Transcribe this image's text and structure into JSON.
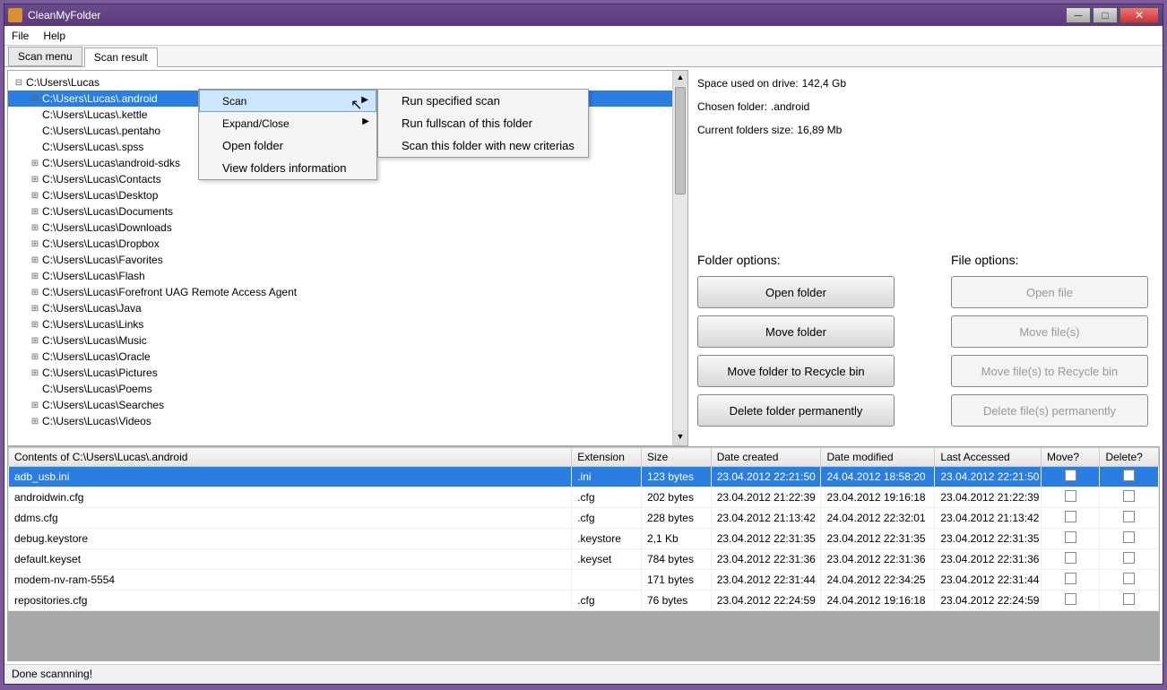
{
  "window": {
    "title": "CleanMyFolder"
  },
  "menubar": [
    "File",
    "Help"
  ],
  "tabs": {
    "items": [
      "Scan menu",
      "Scan result"
    ],
    "active": 1
  },
  "tree": {
    "root": "C:\\Users\\Lucas",
    "selected": "C:\\Users\\Lucas\\.android",
    "children": [
      {
        "label": "C:\\Users\\Lucas\\.android",
        "exp": true
      },
      {
        "label": "C:\\Users\\Lucas\\.kettle",
        "exp": false
      },
      {
        "label": "C:\\Users\\Lucas\\.pentaho",
        "exp": false
      },
      {
        "label": "C:\\Users\\Lucas\\.spss",
        "exp": false
      },
      {
        "label": "C:\\Users\\Lucas\\android-sdks",
        "exp": true
      },
      {
        "label": "C:\\Users\\Lucas\\Contacts",
        "exp": true
      },
      {
        "label": "C:\\Users\\Lucas\\Desktop",
        "exp": true
      },
      {
        "label": "C:\\Users\\Lucas\\Documents",
        "exp": true
      },
      {
        "label": "C:\\Users\\Lucas\\Downloads",
        "exp": true
      },
      {
        "label": "C:\\Users\\Lucas\\Dropbox",
        "exp": true
      },
      {
        "label": "C:\\Users\\Lucas\\Favorites",
        "exp": true
      },
      {
        "label": "C:\\Users\\Lucas\\Flash",
        "exp": true
      },
      {
        "label": "C:\\Users\\Lucas\\Forefront UAG Remote Access Agent",
        "exp": true
      },
      {
        "label": "C:\\Users\\Lucas\\Java",
        "exp": true
      },
      {
        "label": "C:\\Users\\Lucas\\Links",
        "exp": true
      },
      {
        "label": "C:\\Users\\Lucas\\Music",
        "exp": true
      },
      {
        "label": "C:\\Users\\Lucas\\Oracle",
        "exp": true
      },
      {
        "label": "C:\\Users\\Lucas\\Pictures",
        "exp": true
      },
      {
        "label": "C:\\Users\\Lucas\\Poems",
        "exp": false
      },
      {
        "label": "C:\\Users\\Lucas\\Searches",
        "exp": true
      },
      {
        "label": "C:\\Users\\Lucas\\Videos",
        "exp": true
      }
    ]
  },
  "context_menu_1": [
    "Scan",
    "Expand/Close",
    "Open folder",
    "View folders information"
  ],
  "context_menu_2": [
    "Run specified scan",
    "Run fullscan of this folder",
    "Scan this folder with new criterias"
  ],
  "info": {
    "space_label": "Space used on drive:",
    "space_value": "142,4 Gb",
    "chosen_label": "Chosen folder:",
    "chosen_value": ".android",
    "size_label": "Current folders size:",
    "size_value": "16,89 Mb"
  },
  "folder_options": {
    "header": "Folder options:",
    "buttons": [
      "Open folder",
      "Move folder",
      "Move folder to Recycle  bin",
      "Delete folder permanently"
    ]
  },
  "file_options": {
    "header": "File options:",
    "buttons": [
      "Open file",
      "Move file(s)",
      "Move  file(s) to Recycle bin",
      "Delete  file(s) permanently"
    ]
  },
  "table": {
    "contents_header": "Contents of C:\\Users\\Lucas\\.android",
    "columns": [
      "Extension",
      "Size",
      "Date created",
      "Date modified",
      "Last Accessed",
      "Move?",
      "Delete?"
    ],
    "rows": [
      {
        "name": "adb_usb.ini",
        "ext": ".ini",
        "size": "123 bytes",
        "cr": "23.04.2012 22:21:50",
        "mod": "24.04.2012 18:58:20",
        "acc": "23.04.2012 22:21:50",
        "sel": true
      },
      {
        "name": "androidwin.cfg",
        "ext": ".cfg",
        "size": "202 bytes",
        "cr": "23.04.2012 21:22:39",
        "mod": "23.04.2012 19:16:18",
        "acc": "23.04.2012 21:22:39"
      },
      {
        "name": "ddms.cfg",
        "ext": ".cfg",
        "size": "228 bytes",
        "cr": "23.04.2012 21:13:42",
        "mod": "24.04.2012 22:32:01",
        "acc": "23.04.2012 21:13:42"
      },
      {
        "name": "debug.keystore",
        "ext": ".keystore",
        "size": "2,1 Kb",
        "cr": "23.04.2012 22:31:35",
        "mod": "23.04.2012 22:31:35",
        "acc": "23.04.2012 22:31:35"
      },
      {
        "name": "default.keyset",
        "ext": ".keyset",
        "size": "784 bytes",
        "cr": "23.04.2012 22:31:36",
        "mod": "23.04.2012 22:31:36",
        "acc": "23.04.2012 22:31:36"
      },
      {
        "name": "modem-nv-ram-5554",
        "ext": "",
        "size": "171 bytes",
        "cr": "23.04.2012 22:31:44",
        "mod": "24.04.2012 22:34:25",
        "acc": "23.04.2012 22:31:44"
      },
      {
        "name": "repositories.cfg",
        "ext": ".cfg",
        "size": "76 bytes",
        "cr": "23.04.2012 22:24:59",
        "mod": "24.04.2012 19:16:18",
        "acc": "23.04.2012 22:24:59"
      }
    ]
  },
  "status": "Done scannning!"
}
